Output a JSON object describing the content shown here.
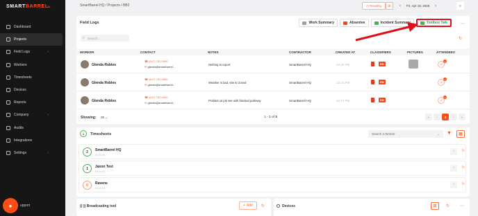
{
  "sidebar": {
    "brand_left": "SMART",
    "brand_right": "BARREL",
    "brand_sub": "1k",
    "items": [
      {
        "label": "Dashboard",
        "icon": "dashboard-icon",
        "has_chevron": false
      },
      {
        "label": "Projects",
        "icon": "projects-icon",
        "has_chevron": false
      },
      {
        "label": "Field Logs",
        "icon": "field-logs-icon",
        "has_chevron": true
      },
      {
        "label": "Workers",
        "icon": "workers-icon",
        "has_chevron": false
      },
      {
        "label": "Timesheets",
        "icon": "timesheets-icon",
        "has_chevron": false
      },
      {
        "label": "Devices",
        "icon": "devices-icon",
        "has_chevron": false
      },
      {
        "label": "Reports",
        "icon": "reports-icon",
        "has_chevron": false
      },
      {
        "label": "Company",
        "icon": "company-icon",
        "has_chevron": true
      },
      {
        "label": "Audits",
        "icon": "audits-icon",
        "has_chevron": false
      },
      {
        "label": "Integrations",
        "icon": "integrations-icon",
        "has_chevron": false
      },
      {
        "label": "Settings",
        "icon": "settings-icon",
        "has_chevron": true
      }
    ],
    "active_index": 1,
    "support_label": "upport"
  },
  "topbar": {
    "breadcrumb": "SmartBarrel HQ  /  Projects  /  BB2",
    "reading_label": "Reading",
    "date_label": "Fri, Apr 18, 2025"
  },
  "field_logs": {
    "title": "Field Logs",
    "tabs": [
      {
        "label": "Work Summary",
        "color": "#9e9e9e"
      },
      {
        "label": "Absentee",
        "color": "#f04a1a"
      },
      {
        "label": "Incident Summary",
        "color": "#4caf50"
      },
      {
        "label": "Toolbox Talk",
        "color": "#4caf50"
      }
    ],
    "search_placeholder": "Search...",
    "columns": [
      "WORKER",
      "CONTACT",
      "NOTES",
      "CONTRACTOR",
      "CREATED AT",
      "CLASSIFIERS",
      "PICTURES",
      "ATTENDEES"
    ],
    "rows": [
      {
        "worker": "Glenda Robles",
        "phone": "(647) 782-0690",
        "email": "glenda@smartbarrel...",
        "note": "Nothing to report",
        "contractor": "SmartBarrel HQ",
        "created": "12:35 PM",
        "classifier": "EN",
        "has_picture": true,
        "attendees": "2"
      },
      {
        "worker": "Glenda Robles",
        "phone": "(647) 782-0690",
        "email": "glenda@smartbarrel...",
        "note": "Weather is bad, site is closed",
        "contractor": "SmartBarrel HQ",
        "created": "12:24 PM",
        "classifier": "EN",
        "has_picture": false,
        "attendees": "2"
      },
      {
        "worker": "Glenda Robles",
        "phone": "(647) 782-0690",
        "email": "glenda@smartbarrel...",
        "note": "Problem at job site with blocked pathway",
        "contractor": "SmartBarrel HQ",
        "created": "12:17 PM",
        "classifier": "EN",
        "has_picture": false,
        "attendees": "2"
      }
    ],
    "showing_label": "Showing:",
    "page_size": "25",
    "range_prefix": "1 - 3 of ",
    "range_total": "3",
    "current_page": "1"
  },
  "timesheets": {
    "title": "Timesheets",
    "header_count": "1",
    "search_placeholder": "Search a Worker",
    "rows": [
      {
        "name": "SmartBarrel HQ",
        "time": "00:00:00",
        "count": "2",
        "warn": false
      },
      {
        "name": "Jaxon Test",
        "time": "00:00:00",
        "count": "1",
        "warn": false
      },
      {
        "name": "Ravens",
        "time": "00:00:00",
        "count": "0",
        "warn": true
      }
    ]
  },
  "broadcasting": {
    "title": "Broadcasting tool",
    "add_label": "Add"
  },
  "devices": {
    "title": "Devices"
  },
  "colors": {
    "accent": "#ff4d17",
    "highlight_box": "#e0101a",
    "sidebar_bg": "#161616"
  }
}
